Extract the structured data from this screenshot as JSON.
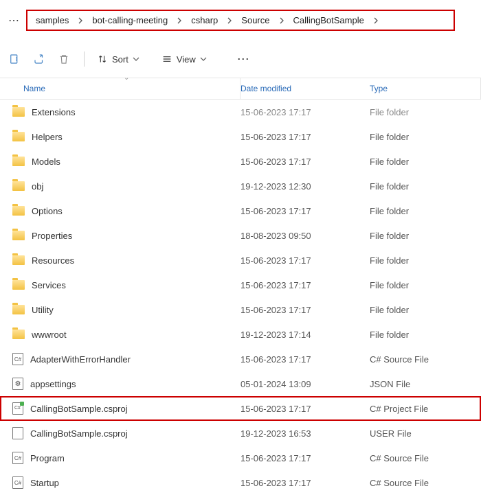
{
  "breadcrumb": [
    "samples",
    "bot-calling-meeting",
    "csharp",
    "Source",
    "CallingBotSample"
  ],
  "toolbar": {
    "sort": "Sort",
    "view": "View"
  },
  "columns": {
    "name": "Name",
    "date": "Date modified",
    "type": "Type"
  },
  "items": [
    {
      "icon": "folder",
      "name": "Extensions",
      "date": "15-06-2023 17:17",
      "type": "File folder",
      "faded": true
    },
    {
      "icon": "folder",
      "name": "Helpers",
      "date": "15-06-2023 17:17",
      "type": "File folder"
    },
    {
      "icon": "folder",
      "name": "Models",
      "date": "15-06-2023 17:17",
      "type": "File folder"
    },
    {
      "icon": "folder",
      "name": "obj",
      "date": "19-12-2023 12:30",
      "type": "File folder"
    },
    {
      "icon": "folder",
      "name": "Options",
      "date": "15-06-2023 17:17",
      "type": "File folder"
    },
    {
      "icon": "folder",
      "name": "Properties",
      "date": "18-08-2023 09:50",
      "type": "File folder"
    },
    {
      "icon": "folder",
      "name": "Resources",
      "date": "15-06-2023 17:17",
      "type": "File folder"
    },
    {
      "icon": "folder",
      "name": "Services",
      "date": "15-06-2023 17:17",
      "type": "File folder"
    },
    {
      "icon": "folder",
      "name": "Utility",
      "date": "15-06-2023 17:17",
      "type": "File folder"
    },
    {
      "icon": "folder",
      "name": "wwwroot",
      "date": "19-12-2023 17:14",
      "type": "File folder"
    },
    {
      "icon": "cs",
      "name": "AdapterWithErrorHandler",
      "date": "15-06-2023 17:17",
      "type": "C# Source File"
    },
    {
      "icon": "json",
      "name": "appsettings",
      "date": "05-01-2024 13:09",
      "type": "JSON File"
    },
    {
      "icon": "csproj",
      "name": "CallingBotSample.csproj",
      "date": "15-06-2023 17:17",
      "type": "C# Project File",
      "highlight": true
    },
    {
      "icon": "user",
      "name": "CallingBotSample.csproj",
      "date": "19-12-2023 16:53",
      "type": "USER File"
    },
    {
      "icon": "cs",
      "name": "Program",
      "date": "15-06-2023 17:17",
      "type": "C# Source File"
    },
    {
      "icon": "cs",
      "name": "Startup",
      "date": "15-06-2023 17:17",
      "type": "C# Source File"
    }
  ]
}
